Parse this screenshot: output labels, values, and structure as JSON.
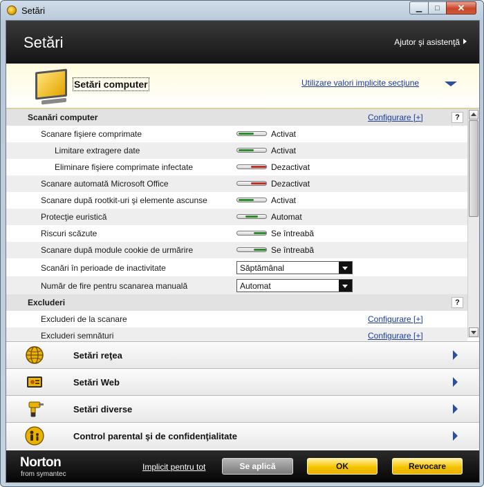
{
  "window": {
    "title": "Setări"
  },
  "header": {
    "title": "Setări",
    "help": "Ajutor şi asistenţă"
  },
  "section": {
    "title": "Setări computer",
    "defaults_link": "Utilizare valori implicite secţiune"
  },
  "list": {
    "group1": {
      "title": "Scanări computer",
      "link": "Configurare [+]",
      "help": "?"
    },
    "rows": [
      {
        "label": "Scanare fişiere comprimate",
        "state": "Activat",
        "toggle": "on"
      },
      {
        "label": "Limitare extragere date",
        "state": "Activat",
        "toggle": "on"
      },
      {
        "label": "Eliminare fişiere comprimate infectate",
        "state": "Dezactivat",
        "toggle": "off"
      },
      {
        "label": "Scanare automată Microsoft Office",
        "state": "Dezactivat",
        "toggle": "off"
      },
      {
        "label": "Scanare după rootkit-uri şi elemente ascunse",
        "state": "Activat",
        "toggle": "on"
      },
      {
        "label": "Protecţie euristică",
        "state": "Automat",
        "toggle": "auto"
      },
      {
        "label": "Riscuri scăzute",
        "state": "Se întreabă",
        "toggle": "ask"
      },
      {
        "label": "Scanare după module cookie de urmărire",
        "state": "Se întreabă",
        "toggle": "ask"
      }
    ],
    "select_idle": {
      "label": "Scanări în perioade de inactivitate",
      "value": "Săptămânal"
    },
    "select_threads": {
      "label": "Număr de fire pentru scanarea manuală",
      "value": "Automat"
    },
    "group2": {
      "title": "Excluderi",
      "help": "?"
    },
    "excl_scan": {
      "label": "Excluderi de la scanare",
      "link": "Configurare [+]"
    },
    "excl_sig": {
      "label": "Excluderi semnături",
      "link": "Configurare [+]"
    }
  },
  "categories": [
    {
      "label": "Setări reţea",
      "icon": "globe-icon"
    },
    {
      "label": "Setări Web",
      "icon": "web-icon"
    },
    {
      "label": "Setări diverse",
      "icon": "drill-icon"
    },
    {
      "label": "Control parental şi de confidenţialitate",
      "icon": "family-icon"
    }
  ],
  "footer": {
    "brand": "Norton",
    "brand_sub": "from symantec",
    "defaults_all": "Implicit pentru tot",
    "apply": "Se aplică",
    "ok": "OK",
    "cancel": "Revocare"
  },
  "colors": {
    "accent_yellow": "#f5c400",
    "link_blue": "#1a3aa0",
    "on_green": "#2e8b2e",
    "off_red": "#c0302a"
  }
}
